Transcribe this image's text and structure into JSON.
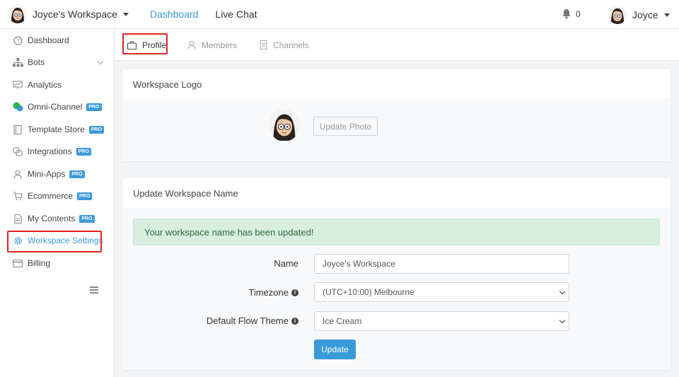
{
  "header": {
    "workspace_name": "Joyce's Workspace",
    "nav": [
      "Dashboard",
      "Live Chat"
    ],
    "notification_count": "0",
    "user_name": "Joyce"
  },
  "sidebar": {
    "items": [
      {
        "label": "Dashboard",
        "icon": "gauge-icon"
      },
      {
        "label": "Bots",
        "icon": "sitemap-icon"
      },
      {
        "label": "Analytics",
        "icon": "chart-board-icon"
      },
      {
        "label": "Omni-Channel",
        "icon": "chat-bubbles-icon",
        "badge": "PRO"
      },
      {
        "label": "Template Store",
        "icon": "book-icon",
        "badge": "PRO"
      },
      {
        "label": "Integrations",
        "icon": "integrations-icon",
        "badge": "PRO"
      },
      {
        "label": "Mini-Apps",
        "icon": "user-icon",
        "badge": "PRO"
      },
      {
        "label": "Ecommerce",
        "icon": "cart-icon",
        "badge": "PRO"
      },
      {
        "label": "My Contents",
        "icon": "document-icon",
        "badge": "PRO"
      },
      {
        "label": "Workspace Settings",
        "icon": "gear-icon"
      },
      {
        "label": "Billing",
        "icon": "credit-card-icon"
      }
    ]
  },
  "tabs": [
    "Profile",
    "Members",
    "Channels"
  ],
  "logo_card": {
    "title": "Workspace Logo",
    "button": "Update Photo"
  },
  "name_card": {
    "title": "Update Workspace Name",
    "alert": "Your workspace name has been updated!",
    "name_label": "Name",
    "name_value": "Joyce's Workspace",
    "timezone_label": "Timezone",
    "timezone_value": "(UTC+10:00) Melbourne",
    "theme_label": "Default Flow Theme",
    "theme_value": "Ice Cream",
    "submit": "Update"
  },
  "colors": {
    "accent": "#3a9ad9",
    "highlight": "#e02424",
    "success_bg": "#d8eedf"
  }
}
